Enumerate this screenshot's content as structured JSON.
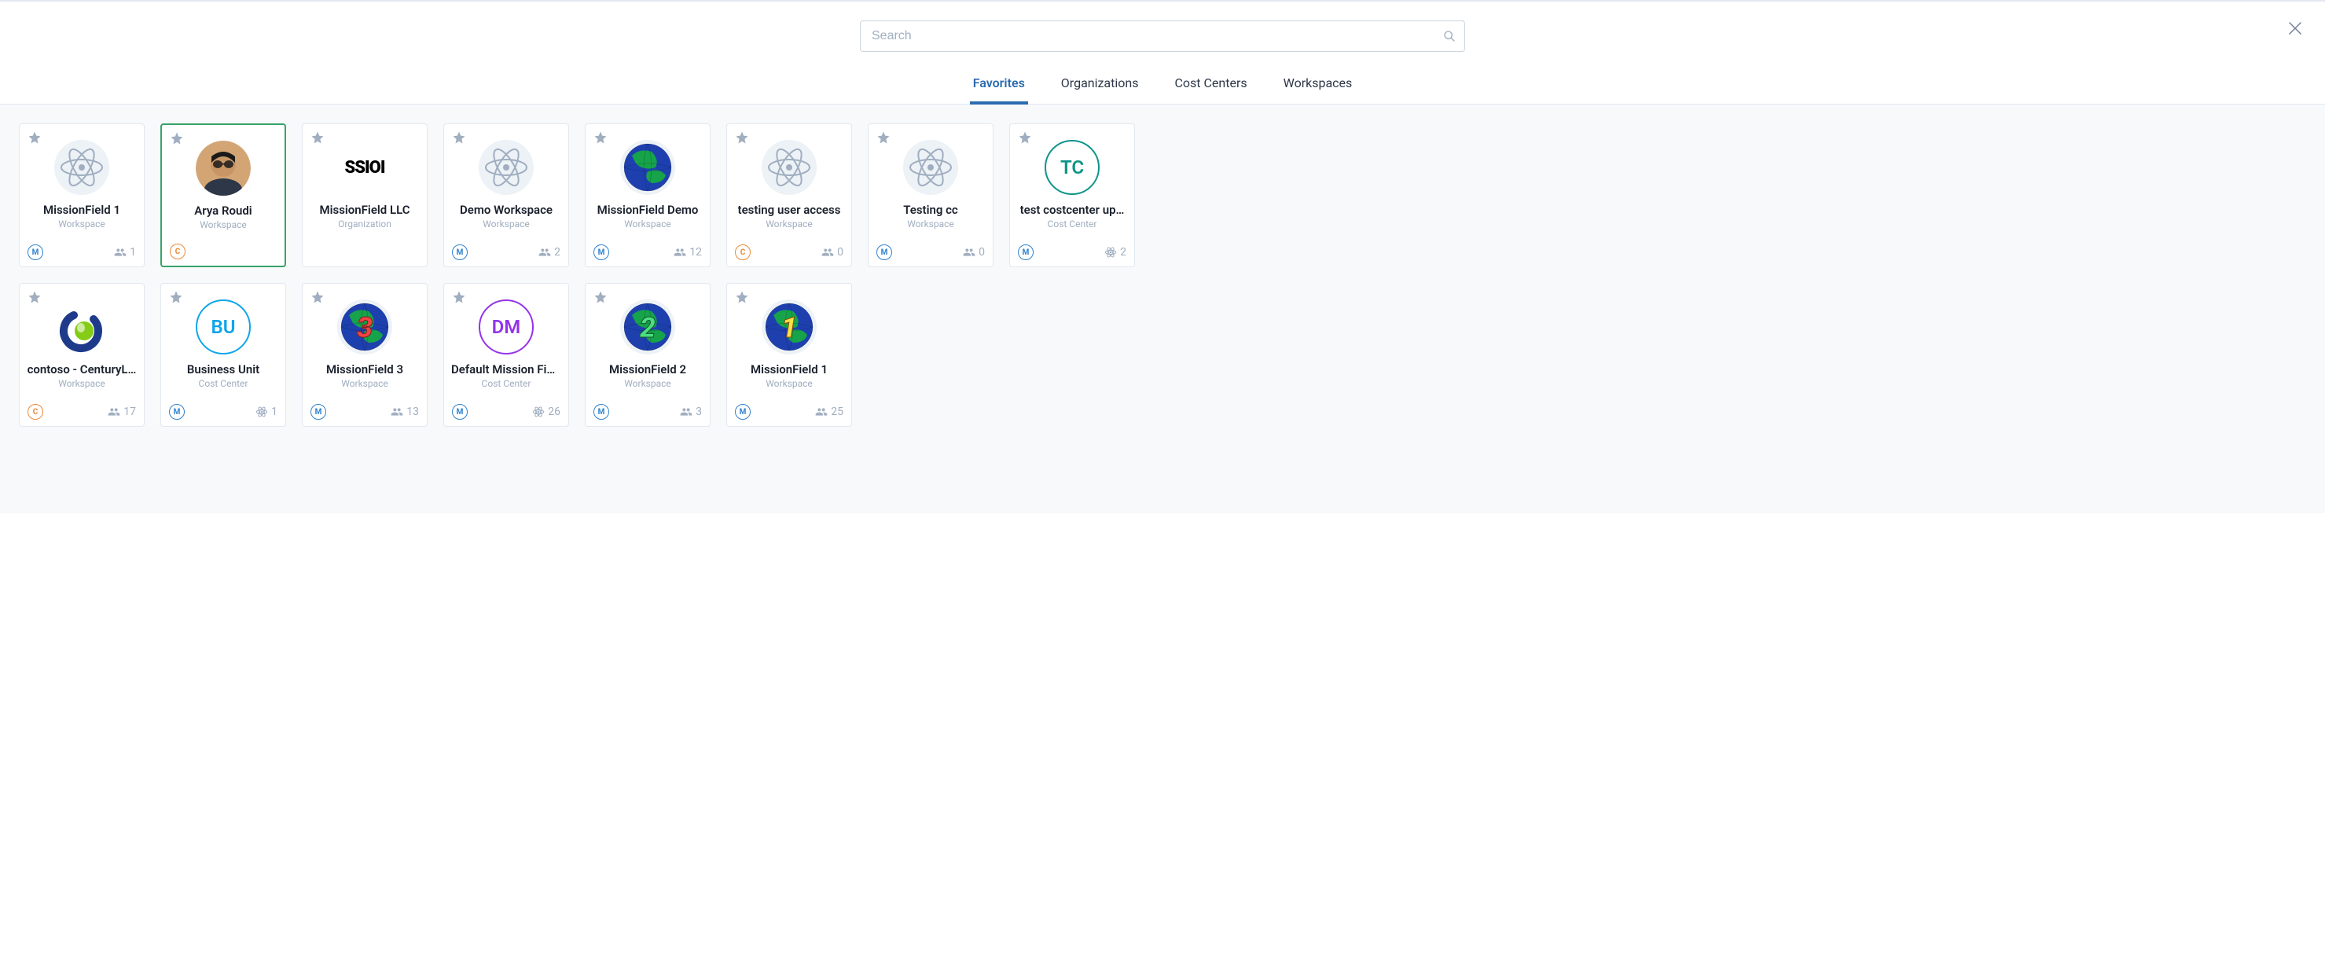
{
  "search": {
    "placeholder": "Search"
  },
  "tabs": {
    "favorites": "Favorites",
    "organizations": "Organizations",
    "cost_centers": "Cost Centers",
    "workspaces": "Workspaces"
  },
  "cards": [
    {
      "title": "MissionField 1",
      "sub": "Workspace",
      "badge": "M",
      "badge_kind": "m",
      "count": "1",
      "count_icon": "users",
      "avatar": "atom",
      "selected": false
    },
    {
      "title": "Arya Roudi",
      "sub": "Workspace",
      "badge": "C",
      "badge_kind": "c",
      "count": "",
      "count_icon": "",
      "avatar": "person",
      "selected": true
    },
    {
      "title": "MissionField LLC",
      "sub": "Organization",
      "badge": "",
      "badge_kind": "",
      "count": "",
      "count_icon": "",
      "avatar": "ssio",
      "selected": false
    },
    {
      "title": "Demo Workspace",
      "sub": "Workspace",
      "badge": "M",
      "badge_kind": "m",
      "count": "2",
      "count_icon": "users",
      "avatar": "atom",
      "selected": false
    },
    {
      "title": "MissionField Demo",
      "sub": "Workspace",
      "badge": "M",
      "badge_kind": "m",
      "count": "12",
      "count_icon": "users",
      "avatar": "globe",
      "selected": false
    },
    {
      "title": "testing user access",
      "sub": "Workspace",
      "badge": "C",
      "badge_kind": "c",
      "count": "0",
      "count_icon": "users",
      "avatar": "atom",
      "selected": false
    },
    {
      "title": "Testing cc",
      "sub": "Workspace",
      "badge": "M",
      "badge_kind": "m",
      "count": "0",
      "count_icon": "users",
      "avatar": "atom",
      "selected": false
    },
    {
      "title": "test costcenter up…",
      "sub": "Cost Center",
      "badge": "M",
      "badge_kind": "m",
      "count": "2",
      "count_icon": "atom",
      "avatar": "tc",
      "selected": false
    },
    {
      "title": "contoso - CenturyL…",
      "sub": "Workspace",
      "badge": "C",
      "badge_kind": "c",
      "count": "17",
      "count_icon": "users",
      "avatar": "contoso",
      "selected": false
    },
    {
      "title": "Business Unit",
      "sub": "Cost Center",
      "badge": "M",
      "badge_kind": "m",
      "count": "1",
      "count_icon": "atom",
      "avatar": "bu",
      "selected": false
    },
    {
      "title": "MissionField 3",
      "sub": "Workspace",
      "badge": "M",
      "badge_kind": "m",
      "count": "13",
      "count_icon": "users",
      "avatar": "globe3",
      "selected": false
    },
    {
      "title": "Default Mission Fie…",
      "sub": "Cost Center",
      "badge": "M",
      "badge_kind": "m",
      "count": "26",
      "count_icon": "atom",
      "avatar": "dm",
      "selected": false
    },
    {
      "title": "MissionField 2",
      "sub": "Workspace",
      "badge": "M",
      "badge_kind": "m",
      "count": "3",
      "count_icon": "users",
      "avatar": "globe2",
      "selected": false
    },
    {
      "title": "MissionField 1",
      "sub": "Workspace",
      "badge": "M",
      "badge_kind": "m",
      "count": "25",
      "count_icon": "users",
      "avatar": "globe1",
      "selected": false
    }
  ],
  "avatar_text": {
    "tc": "TC",
    "bu": "BU",
    "dm": "DM",
    "ssio": "SSIOI"
  }
}
